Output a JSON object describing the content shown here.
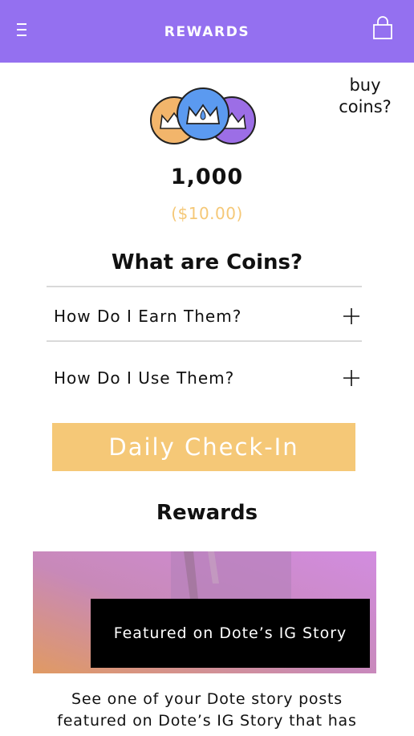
{
  "header": {
    "title": "REWARDS",
    "menu_icon": "hamburger-menu-icon",
    "bag_icon": "shopping-bag-icon",
    "background_color": "#9470f0"
  },
  "buy_coins": {
    "line1": "buy",
    "line2": "coins?"
  },
  "coins": {
    "amount": "1,000",
    "dollar_value": "($10.00)",
    "dollar_color": "#f5c877"
  },
  "faq": {
    "title": "What are Coins?",
    "items": [
      {
        "label": "How Do I Earn Them?",
        "icon": "plus-icon"
      },
      {
        "label": "How Do I Use Them?",
        "icon": "plus-icon"
      }
    ]
  },
  "checkin": {
    "label": "Daily Check-In",
    "color": "#f5c877"
  },
  "rewards": {
    "title": "Rewards",
    "cards": [
      {
        "caption": "Featured on Dote’s IG Story",
        "description_line1": "See one of your Dote story posts",
        "description_line2": "featured on Dote’s IG Story that has"
      }
    ]
  }
}
